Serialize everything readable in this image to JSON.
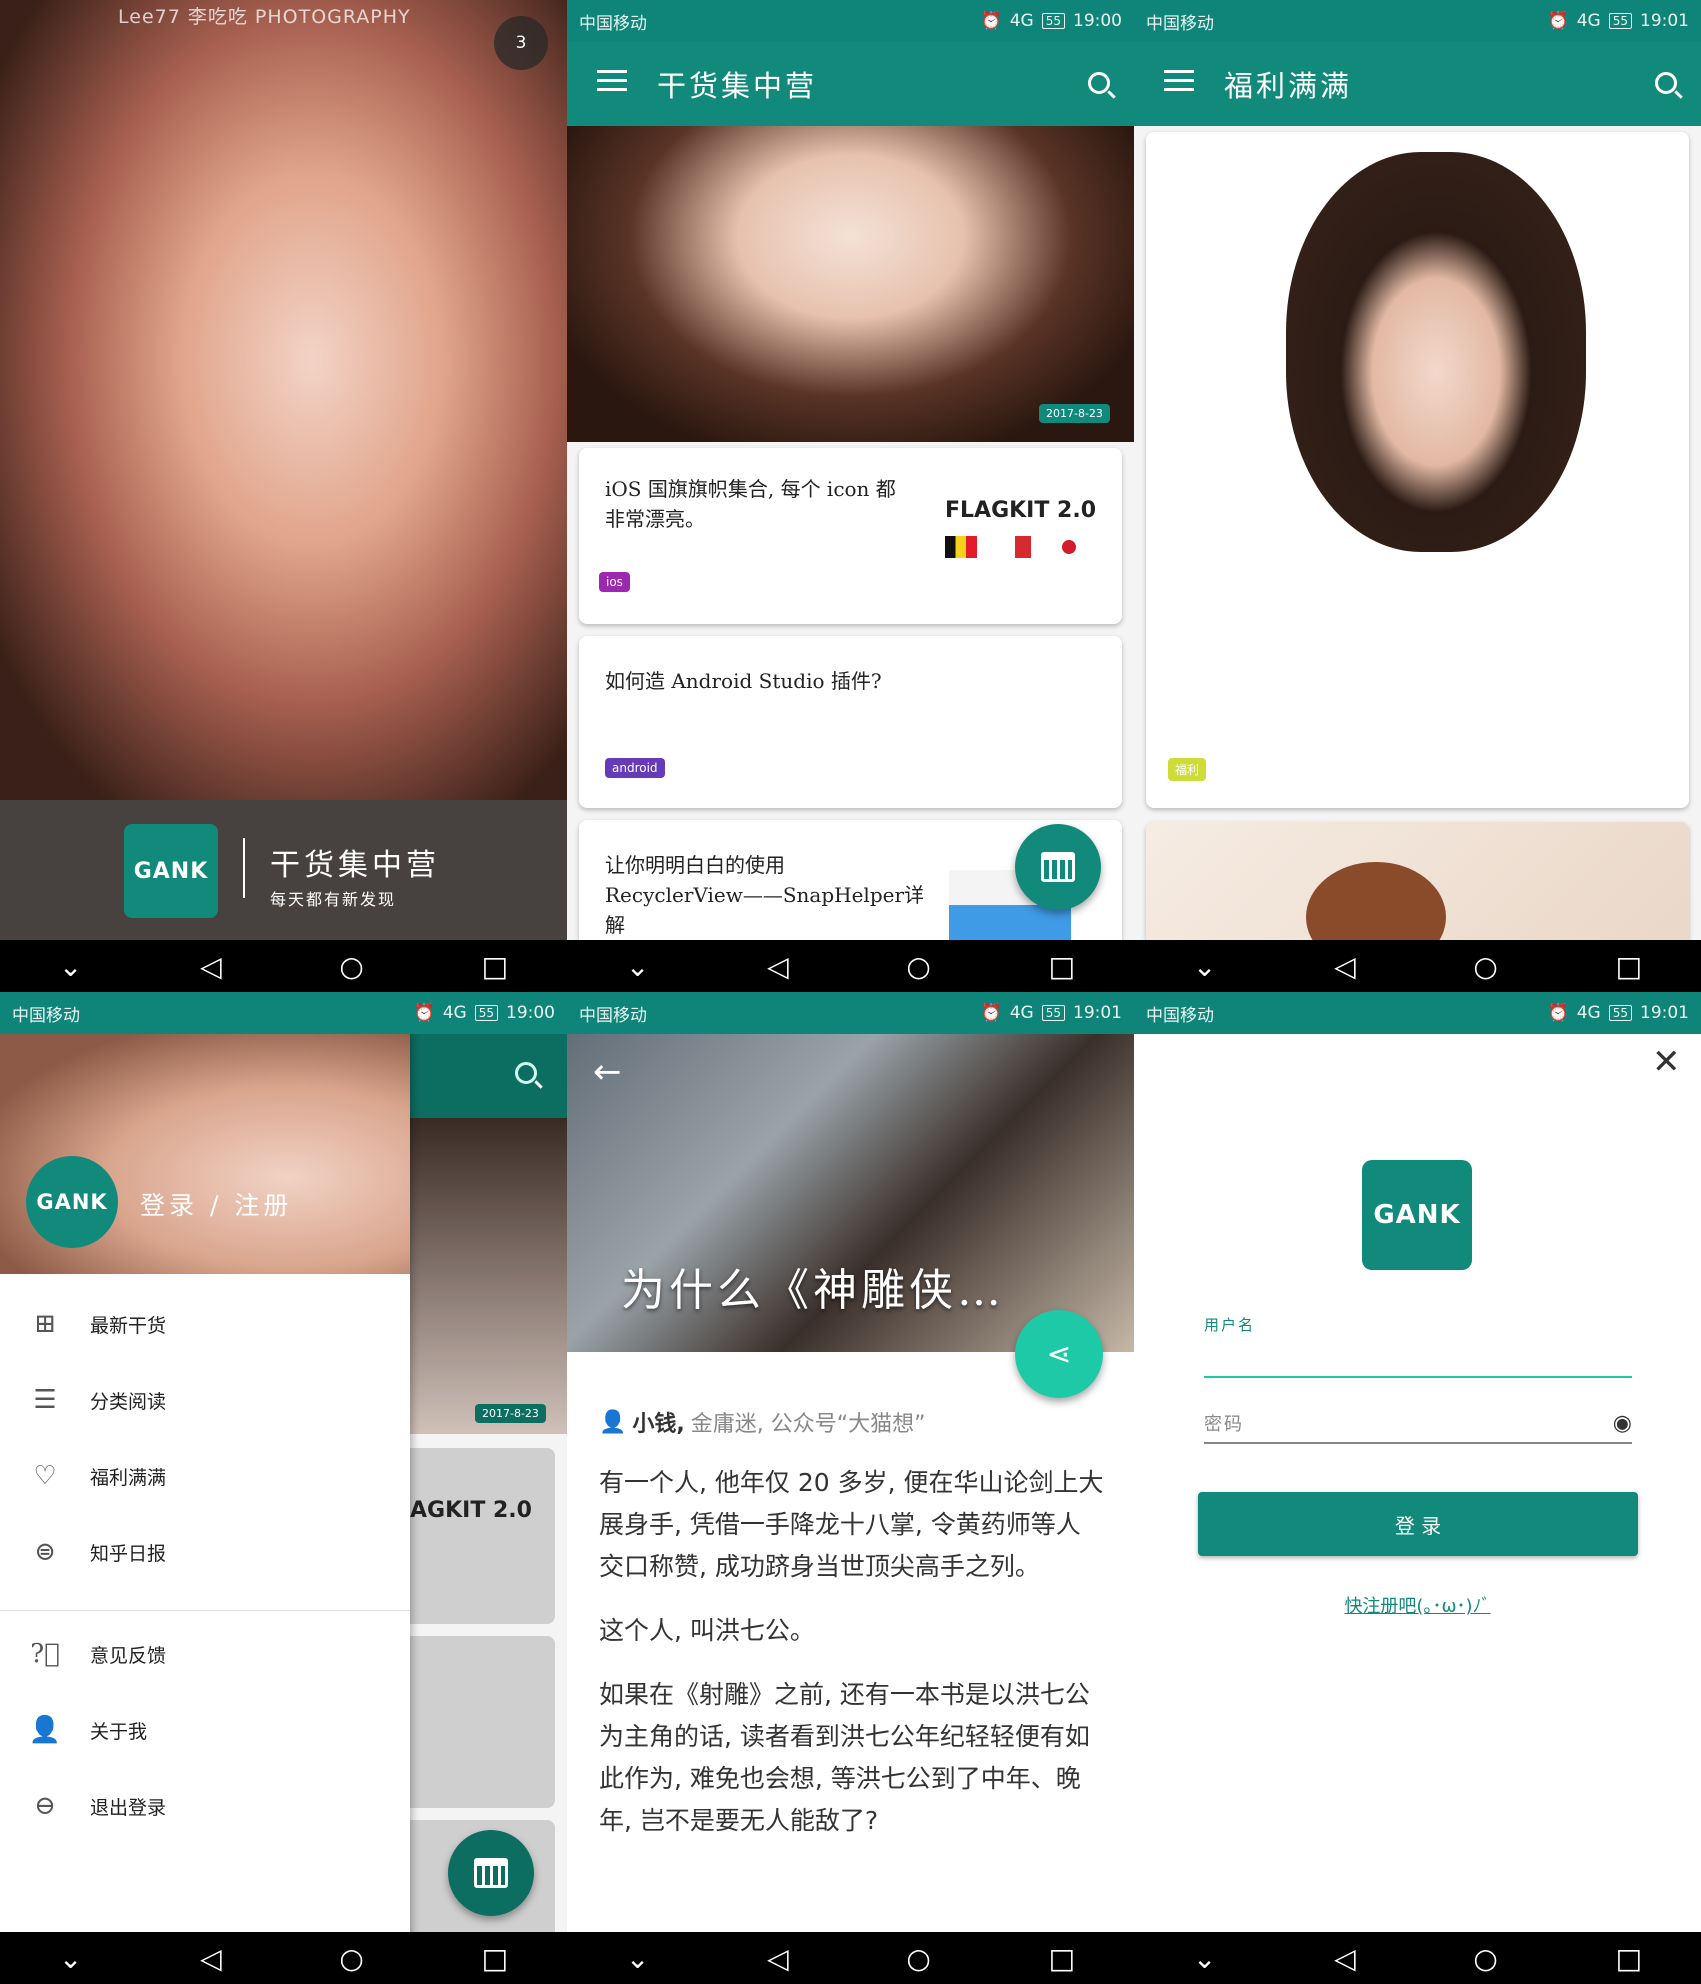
{
  "status": {
    "carrier": "中国移动",
    "network": "4G",
    "battery": "55",
    "times": [
      "19:00",
      "19:01",
      "19:00",
      "19:01",
      "19:01"
    ]
  },
  "splash": {
    "watermark": "Lee77  李吃吃  PHOTOGRAPHY",
    "skip_count": "3",
    "logo": "GANK",
    "app_title": "干货集中营",
    "slogan": "每天都有新发现"
  },
  "home": {
    "toolbar_title": "干货集中营",
    "hero_date": "2017-8-23",
    "cards": [
      {
        "title": "iOS 国旗旗帜集合, 每个 icon 都非常漂亮。",
        "tag": "ios",
        "thumb": "FLAGKIT 2.0"
      },
      {
        "title": "如何造 Android Studio 插件?",
        "tag": "android"
      },
      {
        "title": "让你明明白白的使用 RecyclerView——SnapHelper详解"
      }
    ]
  },
  "welfare": {
    "toolbar_title": "福利满满",
    "tag": "福利"
  },
  "drawer": {
    "logo": "GANK",
    "login": "登录 / 注册",
    "items": [
      {
        "label": "最新干货",
        "icon": "grid-icon"
      },
      {
        "label": "分类阅读",
        "icon": "list-icon"
      },
      {
        "label": "福利满满",
        "icon": "heart-icon"
      },
      {
        "label": "知乎日报",
        "icon": "menu-circle-icon"
      }
    ],
    "items2": [
      {
        "label": "意见反馈",
        "icon": "help-icon"
      },
      {
        "label": "关于我",
        "icon": "user-icon"
      },
      {
        "label": "退出登录",
        "icon": "minus-circle-icon"
      }
    ],
    "bg_date": "2017-8-23",
    "bg_thumb": "AGKIT 2.0"
  },
  "article": {
    "title": "为什么《神雕侠…",
    "author": "小钱,",
    "author_desc": "金庸迷, 公众号“大猫想”",
    "paragraphs": [
      "有一个人, 他年仅 20 多岁, 便在华山论剑上大展身手, 凭借一手降龙十八掌, 令黄药师等人交口称赞, 成功跻身当世顶尖高手之列。",
      "这个人, 叫洪七公。",
      "如果在《射雕》之前, 还有一本书是以洪七公为主角的话, 读者看到洪七公年纪轻轻便有如此作为, 难免也会想, 等洪七公到了中年、晚年, 岂不是要无人能敌了?"
    ]
  },
  "login": {
    "logo": "GANK",
    "username_label": "用户名",
    "password_placeholder": "密码",
    "login_button": "登 录",
    "register_link": "快注册吧(｡･ω･)ﾉﾞ"
  },
  "colors": {
    "primary": "#128a7b",
    "accent": "#1ec9a7",
    "ios_tag": "#9c27b0",
    "android_tag": "#673ab7",
    "welfare_tag": "#cddc39"
  }
}
